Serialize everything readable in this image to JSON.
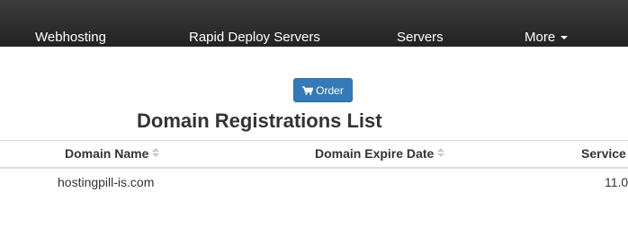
{
  "nav": {
    "items": [
      {
        "label": "Webhosting"
      },
      {
        "label": "Rapid Deploy Servers"
      },
      {
        "label": "Servers"
      },
      {
        "label": "More"
      }
    ]
  },
  "order_button": {
    "label": "Order",
    "icon": "shopping-cart-icon"
  },
  "page_title": "Domain Registrations List",
  "table": {
    "columns": [
      "Domain Name",
      "Domain Expire Date",
      "Service"
    ],
    "rows": [
      {
        "domain": "hostingpill-is.com",
        "expire": "",
        "service": "11.0"
      }
    ]
  },
  "colors": {
    "navbar": "#222222",
    "primary_button": "#337ab7",
    "text": "#333333",
    "border": "#dddddd"
  }
}
